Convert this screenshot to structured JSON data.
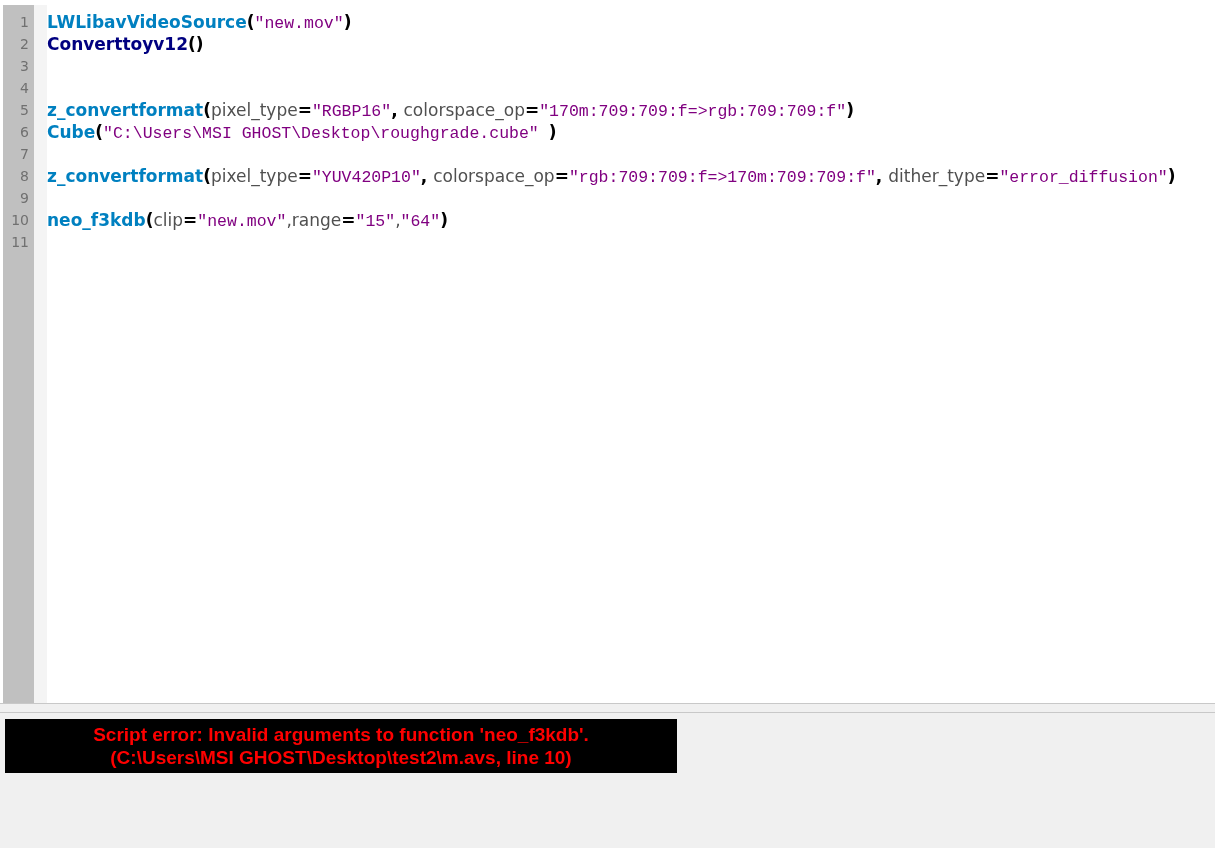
{
  "editor": {
    "lines": [
      {
        "number": "1",
        "tokens": [
          {
            "kind": "function",
            "text": "LWLibavVideoSource"
          },
          {
            "kind": "bracket",
            "text": "("
          },
          {
            "kind": "string",
            "text": "\"new.mov\""
          },
          {
            "kind": "bracket",
            "text": ")"
          }
        ]
      },
      {
        "number": "2",
        "tokens": [
          {
            "kind": "internal",
            "text": "Converttoyv12"
          },
          {
            "kind": "bracket",
            "text": "()"
          }
        ]
      },
      {
        "number": "3"
      },
      {
        "number": "4"
      },
      {
        "number": "5",
        "tokens": [
          {
            "kind": "function",
            "text": "z_convertformat"
          },
          {
            "kind": "bracket",
            "text": "("
          },
          {
            "kind": "argument",
            "text": "pixel_type"
          },
          {
            "kind": "operator",
            "text": "="
          },
          {
            "kind": "string",
            "text": "\"RGBP16\""
          },
          {
            "kind": "operator",
            "text": ", "
          },
          {
            "kind": "argument",
            "text": "colorspace_op"
          },
          {
            "kind": "operator",
            "text": "="
          },
          {
            "kind": "string",
            "text": "\"170m:709:709:f=>rgb:709:709:f\""
          },
          {
            "kind": "bracket",
            "text": ")"
          }
        ]
      },
      {
        "number": "6",
        "tokens": [
          {
            "kind": "function",
            "text": "Cube"
          },
          {
            "kind": "bracket",
            "text": "("
          },
          {
            "kind": "string",
            "text": "\"C:\\Users\\MSI GHOST\\Desktop\\roughgrade.cube\" "
          },
          {
            "kind": "bracket",
            "text": ")"
          }
        ]
      },
      {
        "number": "7"
      },
      {
        "number": "8",
        "tokens": [
          {
            "kind": "function",
            "text": "z_convertformat"
          },
          {
            "kind": "bracket",
            "text": "("
          },
          {
            "kind": "argument",
            "text": "pixel_type"
          },
          {
            "kind": "operator",
            "text": "="
          },
          {
            "kind": "string",
            "text": "\"YUV420P10\""
          },
          {
            "kind": "operator",
            "text": ", "
          },
          {
            "kind": "argument",
            "text": "colorspace_op"
          },
          {
            "kind": "operator",
            "text": "="
          },
          {
            "kind": "string",
            "text": "\"rgb:709:709:f=>170m:709:709:f\""
          },
          {
            "kind": "operator",
            "text": ", "
          },
          {
            "kind": "argument",
            "text": "dither_type"
          },
          {
            "kind": "operator",
            "text": "="
          },
          {
            "kind": "string",
            "text": "\"error_diffusion\""
          },
          {
            "kind": "bracket",
            "text": ")"
          }
        ]
      },
      {
        "number": "9"
      },
      {
        "number": "10",
        "tokens": [
          {
            "kind": "function",
            "text": "neo_f3kdb"
          },
          {
            "kind": "bracket",
            "text": "("
          },
          {
            "kind": "argument",
            "text": "clip"
          },
          {
            "kind": "operator",
            "text": "="
          },
          {
            "kind": "string",
            "text": "\"new.mov\""
          },
          {
            "kind": "argument",
            "text": ","
          },
          {
            "kind": "argument",
            "text": "range"
          },
          {
            "kind": "operator",
            "text": "="
          },
          {
            "kind": "string",
            "text": "\"15\""
          },
          {
            "kind": "argument",
            "text": ","
          },
          {
            "kind": "string",
            "text": "\"64\""
          },
          {
            "kind": "bracket",
            "text": ")"
          }
        ]
      },
      {
        "number": "11"
      }
    ]
  },
  "error_panel": {
    "lines": [
      "Script error: Invalid arguments to function 'neo_f3kdb'.",
      "(C:\\Users\\MSI GHOST\\Desktop\\test2\\m.avs, line 10)"
    ]
  }
}
